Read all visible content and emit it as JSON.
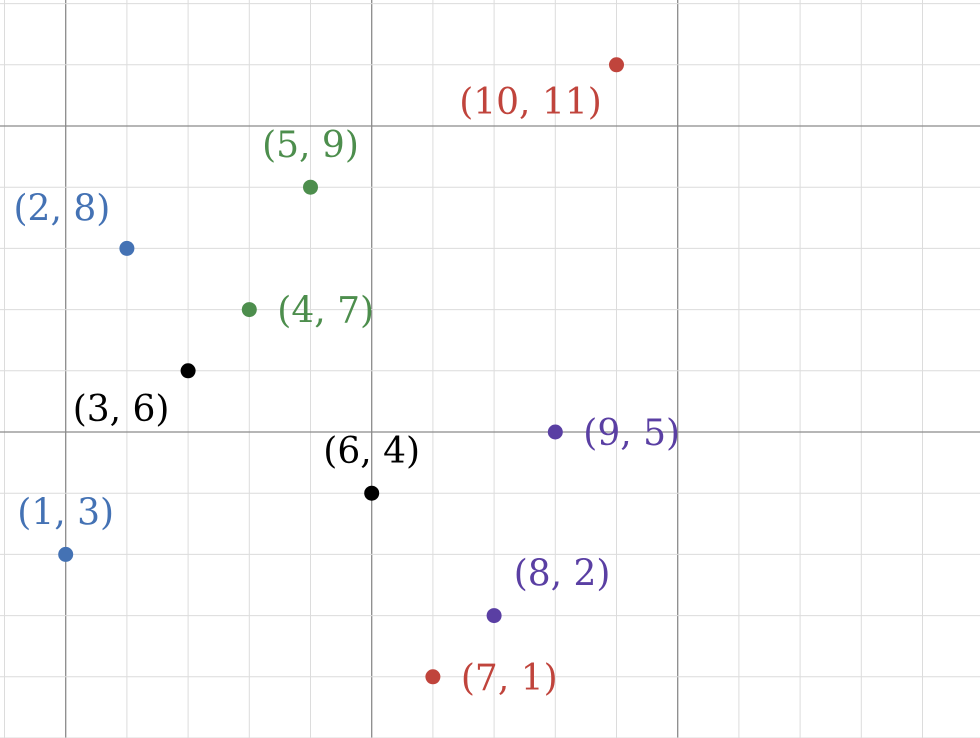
{
  "chart_data": {
    "type": "scatter",
    "title": "",
    "xlabel": "",
    "ylabel": "",
    "xlim": [
      -1,
      15
    ],
    "ylim": [
      0,
      12
    ],
    "grid": true,
    "series": [
      {
        "color": "#4472b4",
        "points": [
          {
            "x": 2,
            "y": 8,
            "label": "(2, 8)"
          },
          {
            "x": 1,
            "y": 3,
            "label": "(1, 3)"
          }
        ]
      },
      {
        "color": "#4d8e4d",
        "points": [
          {
            "x": 5,
            "y": 9,
            "label": "(5, 9)"
          },
          {
            "x": 4,
            "y": 7,
            "label": "(4, 7)"
          }
        ]
      },
      {
        "color": "#000000",
        "points": [
          {
            "x": 3,
            "y": 6,
            "label": "(3, 6)"
          },
          {
            "x": 6,
            "y": 4,
            "label": "(6, 4)"
          }
        ]
      },
      {
        "color": "#5a3fa3",
        "points": [
          {
            "x": 9,
            "y": 5,
            "label": "(9, 5)"
          },
          {
            "x": 8,
            "y": 2,
            "label": "(8, 2)"
          }
        ]
      },
      {
        "color": "#c0443c",
        "points": [
          {
            "x": 10,
            "y": 11,
            "label": "(10, 11)"
          },
          {
            "x": 7,
            "y": 1,
            "label": "(7, 1)"
          }
        ]
      }
    ]
  }
}
